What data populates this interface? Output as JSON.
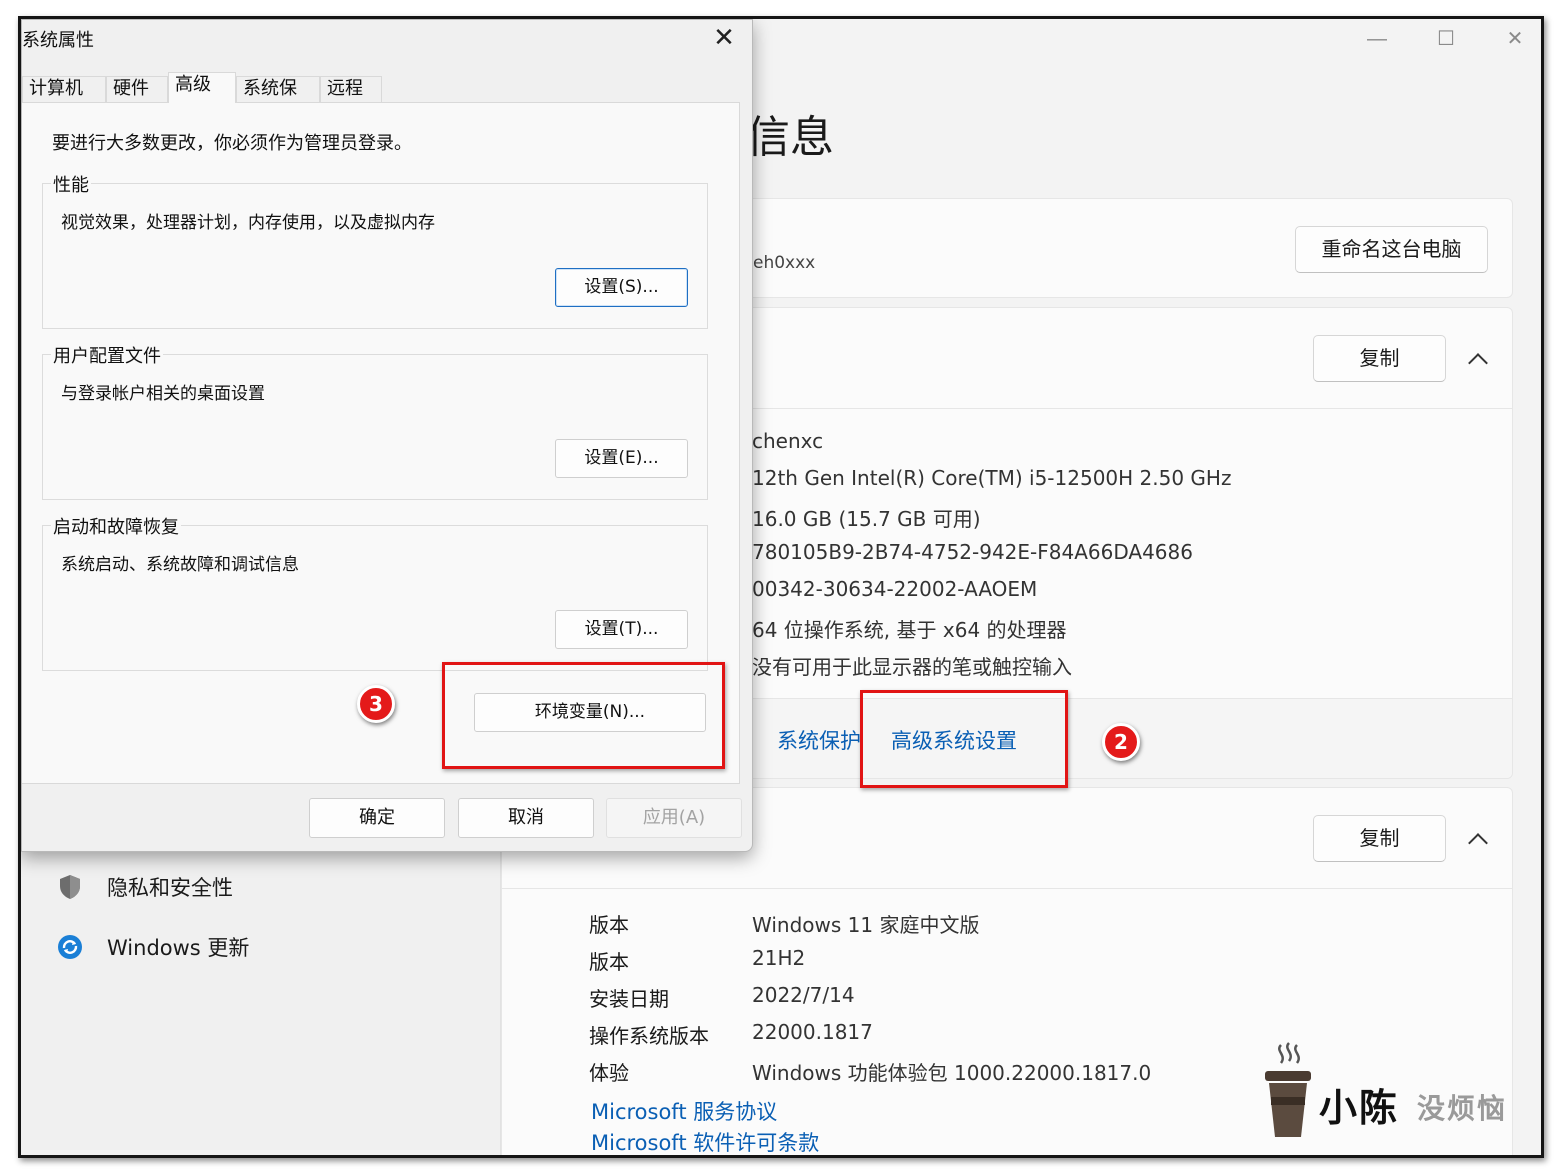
{
  "settings": {
    "window_controls": {
      "minimize": "—",
      "maximize": "☐",
      "close": "✕"
    },
    "page_title": "信息",
    "device": {
      "name_partial": "eh0xxx",
      "rename_button": "重命名这台电脑"
    },
    "device_specs": {
      "copy_button": "复制",
      "values": [
        "chenxc",
        "12th Gen Intel(R) Core(TM) i5-12500H   2.50 GHz",
        "16.0 GB (15.7 GB 可用)",
        "780105B9-2B74-4752-942E-F84A66DA4686",
        "00342-30634-22002-AAOEM",
        "64 位操作系统, 基于 x64 的处理器",
        "没有可用于此显示器的笔或触控输入"
      ],
      "related_links": [
        "系统保护",
        "高级系统设置"
      ]
    },
    "windows_specs": {
      "copy_button": "复制",
      "rows": [
        {
          "label": "版本",
          "value": "Windows 11 家庭中文版"
        },
        {
          "label": "版本",
          "value": "21H2"
        },
        {
          "label": "安装日期",
          "value": "2022/7/14"
        },
        {
          "label": "操作系统版本",
          "value": "22000.1817"
        },
        {
          "label": "体验",
          "value": "Windows 功能体验包 1000.22000.1817.0"
        }
      ],
      "links": [
        "Microsoft 服务协议",
        "Microsoft 软件许可条款"
      ]
    },
    "sidebar": {
      "items": [
        {
          "label": "隐私和安全性",
          "icon": "shield-icon"
        },
        {
          "label": "Windows 更新",
          "icon": "update-icon"
        }
      ]
    }
  },
  "dialog": {
    "title": "系统属性",
    "close": "✕",
    "tabs": [
      "计算机名",
      "硬件",
      "高级",
      "系统保护",
      "远程"
    ],
    "active_tab": "高级",
    "admin_note": "要进行大多数更改，你必须作为管理员登录。",
    "groups": [
      {
        "title": "性能",
        "description": "视觉效果，处理器计划，内存使用，以及虚拟内存",
        "button": "设置(S)..."
      },
      {
        "title": "用户配置文件",
        "description": "与登录帐户相关的桌面设置",
        "button": "设置(E)..."
      },
      {
        "title": "启动和故障恢复",
        "description": "系统启动、系统故障和调试信息",
        "button": "设置(T)..."
      }
    ],
    "env_button": "环境变量(N)...",
    "footer": {
      "ok": "确定",
      "cancel": "取消",
      "apply": "应用(A)"
    }
  },
  "annotations": {
    "step2": "2",
    "step3": "3",
    "highlight_color": "#e11414"
  },
  "watermark": {
    "text_main": "小陈",
    "text_secondary": "没烦恼"
  }
}
